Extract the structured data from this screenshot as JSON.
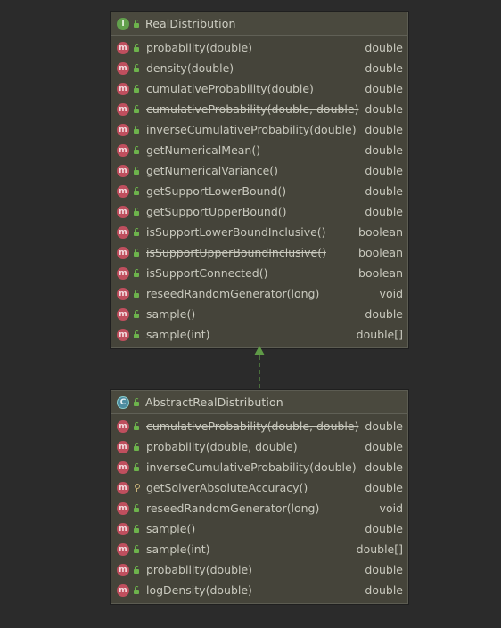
{
  "interface_box": {
    "kind_letter": "I",
    "title": "RealDistribution",
    "methods": [
      {
        "signature": "probability(double)",
        "return_type": "double",
        "deprecated": false,
        "access": "public"
      },
      {
        "signature": "density(double)",
        "return_type": "double",
        "deprecated": false,
        "access": "public"
      },
      {
        "signature": "cumulativeProbability(double)",
        "return_type": "double",
        "deprecated": false,
        "access": "public"
      },
      {
        "signature": "cumulativeProbability(double, double)",
        "return_type": "double",
        "deprecated": true,
        "access": "public"
      },
      {
        "signature": "inverseCumulativeProbability(double)",
        "return_type": "double",
        "deprecated": false,
        "access": "public"
      },
      {
        "signature": "getNumericalMean()",
        "return_type": "double",
        "deprecated": false,
        "access": "public"
      },
      {
        "signature": "getNumericalVariance()",
        "return_type": "double",
        "deprecated": false,
        "access": "public"
      },
      {
        "signature": "getSupportLowerBound()",
        "return_type": "double",
        "deprecated": false,
        "access": "public"
      },
      {
        "signature": "getSupportUpperBound()",
        "return_type": "double",
        "deprecated": false,
        "access": "public"
      },
      {
        "signature": "isSupportLowerBoundInclusive()",
        "return_type": "boolean",
        "deprecated": true,
        "access": "public"
      },
      {
        "signature": "isSupportUpperBoundInclusive()",
        "return_type": "boolean",
        "deprecated": true,
        "access": "public"
      },
      {
        "signature": "isSupportConnected()",
        "return_type": "boolean",
        "deprecated": false,
        "access": "public"
      },
      {
        "signature": "reseedRandomGenerator(long)",
        "return_type": "void",
        "deprecated": false,
        "access": "public"
      },
      {
        "signature": "sample()",
        "return_type": "double",
        "deprecated": false,
        "access": "public"
      },
      {
        "signature": "sample(int)",
        "return_type": "double[]",
        "deprecated": false,
        "access": "public"
      }
    ]
  },
  "class_box": {
    "kind_letter": "C",
    "title": "AbstractRealDistribution",
    "methods": [
      {
        "signature": "cumulativeProbability(double, double)",
        "return_type": "double",
        "deprecated": true,
        "access": "public"
      },
      {
        "signature": "probability(double, double)",
        "return_type": "double",
        "deprecated": false,
        "access": "public"
      },
      {
        "signature": "inverseCumulativeProbability(double)",
        "return_type": "double",
        "deprecated": false,
        "access": "public"
      },
      {
        "signature": "getSolverAbsoluteAccuracy()",
        "return_type": "double",
        "deprecated": false,
        "access": "protected"
      },
      {
        "signature": "reseedRandomGenerator(long)",
        "return_type": "void",
        "deprecated": false,
        "access": "public"
      },
      {
        "signature": "sample()",
        "return_type": "double",
        "deprecated": false,
        "access": "public"
      },
      {
        "signature": "sample(int)",
        "return_type": "double[]",
        "deprecated": false,
        "access": "public"
      },
      {
        "signature": "probability(double)",
        "return_type": "double",
        "deprecated": false,
        "access": "public"
      },
      {
        "signature": "logDensity(double)",
        "return_type": "double",
        "deprecated": false,
        "access": "public"
      }
    ]
  },
  "method_icon_letter": "m",
  "colors": {
    "background": "#2b2b2b",
    "box_fill": "#45443a",
    "method_icon": "#bf4f5e",
    "interface_icon": "#62a04d",
    "class_icon": "#4d8ba0",
    "public_lock": "#6db34c",
    "relation_arrow": "#5f9a47"
  },
  "relationship": {
    "type": "implements",
    "from": "AbstractRealDistribution",
    "to": "RealDistribution",
    "line_style": "dashed"
  }
}
